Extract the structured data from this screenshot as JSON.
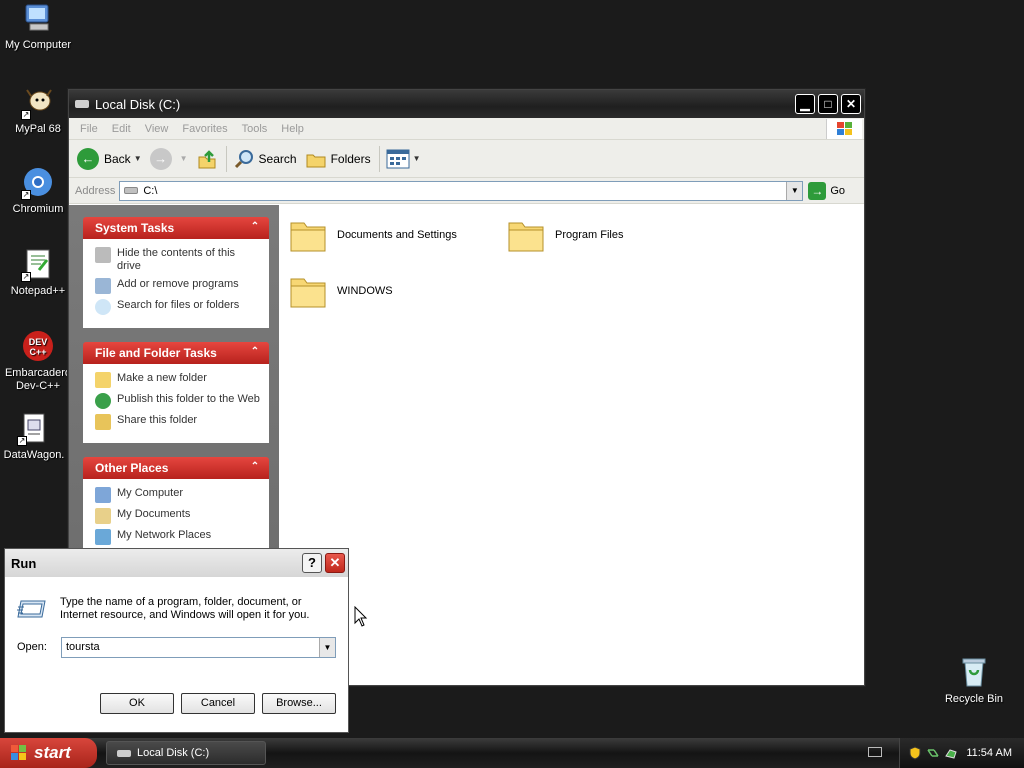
{
  "desktop": {
    "icons": [
      {
        "label": "My Computer"
      },
      {
        "label": "MyPal 68"
      },
      {
        "label": "Chromium"
      },
      {
        "label": "Notepad++"
      },
      {
        "label": "Embarcadero Dev-C++"
      },
      {
        "label": "DataWagon."
      },
      {
        "label": "Recycle Bin"
      }
    ]
  },
  "explorer": {
    "title": "Local Disk (C:)",
    "menu": [
      "File",
      "Edit",
      "View",
      "Favorites",
      "Tools",
      "Help"
    ],
    "toolbar": {
      "back": "Back",
      "search": "Search",
      "folders": "Folders"
    },
    "address": {
      "label": "Address",
      "value": "C:\\",
      "go": "Go"
    },
    "taskpane": [
      {
        "title": "System Tasks",
        "items": [
          "Hide the contents of this drive",
          "Add or remove programs",
          "Search for files or folders"
        ]
      },
      {
        "title": "File and Folder Tasks",
        "items": [
          "Make a new folder",
          "Publish this folder to the Web",
          "Share this folder"
        ]
      },
      {
        "title": "Other Places",
        "items": [
          "My Computer",
          "My Documents",
          "My Network Places"
        ]
      }
    ],
    "files": [
      "Documents and Settings",
      "Program Files",
      "WINDOWS"
    ]
  },
  "run_dialog": {
    "title": "Run",
    "help": "?",
    "description": "Type the name of a program, folder, document, or Internet resource, and Windows will open it for you.",
    "open_label": "Open:",
    "open_value": "toursta",
    "ok": "OK",
    "cancel": "Cancel",
    "browse": "Browse..."
  },
  "taskbar": {
    "start": "start",
    "task": "Local Disk (C:)",
    "clock": "11:54 AM"
  },
  "colors": {
    "accent_red": "#c0281c",
    "desktop": "#1b1b1b"
  }
}
